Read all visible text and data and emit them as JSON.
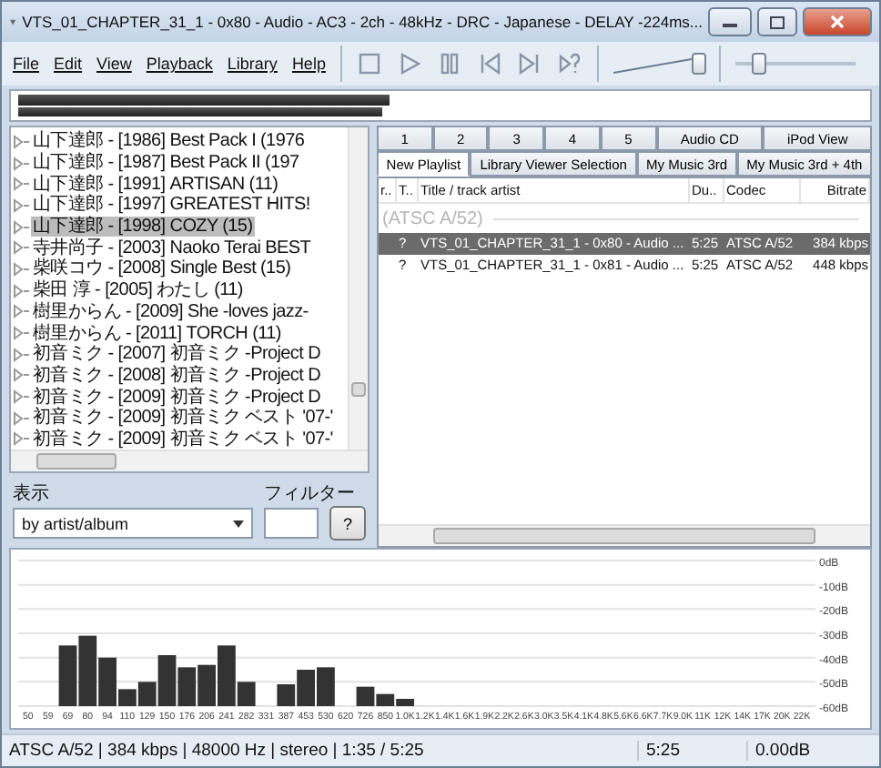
{
  "window": {
    "title": "VTS_01_CHAPTER_31_1 - 0x80 - Audio - AC3 - 2ch - 48kHz - DRC - Japanese - DELAY -224ms..."
  },
  "menu": [
    "File",
    "Edit",
    "View",
    "Playback",
    "Library",
    "Help"
  ],
  "volume": {
    "level": 0.95
  },
  "seek": {
    "level": 0.2
  },
  "peak_meter": [
    {
      "level": 0.44
    },
    {
      "level": 0.43
    }
  ],
  "library_tree": {
    "items": [
      {
        "label": "山下達郎 - [1986] Best Pack I (1976",
        "selected": false
      },
      {
        "label": "山下達郎 - [1987] Best Pack II (197",
        "selected": false
      },
      {
        "label": "山下達郎 - [1991] ARTISAN (11)",
        "selected": false
      },
      {
        "label": "山下達郎 - [1997] GREATEST HITS!",
        "selected": false
      },
      {
        "label": "山下達郎 - [1998] COZY (15)",
        "selected": true
      },
      {
        "label": "寺井尚子 - [2003] Naoko Terai BEST",
        "selected": false
      },
      {
        "label": "柴咲コウ - [2008] Single Best (15)",
        "selected": false
      },
      {
        "label": "柴田 淳 - [2005] わたし (11)",
        "selected": false
      },
      {
        "label": "樹里からん - [2009] She -loves jazz-",
        "selected": false
      },
      {
        "label": "樹里からん - [2011] TORCH (11)",
        "selected": false
      },
      {
        "label": "初音ミク - [2007] 初音ミク -Project D",
        "selected": false
      },
      {
        "label": "初音ミク - [2008] 初音ミク -Project D",
        "selected": false
      },
      {
        "label": "初音ミク - [2009] 初音ミク -Project D",
        "selected": false
      },
      {
        "label": "初音ミク - [2009] 初音ミク ベスト '07-'",
        "selected": false
      },
      {
        "label": "初音ミク - [2009] 初音ミク ベスト '07-'",
        "selected": false
      }
    ],
    "view_label": "表示",
    "view_value": "by artist/album",
    "filter_label": "フィルター",
    "help_button": "?"
  },
  "tabs_row_1": [
    {
      "label": "1",
      "selected": false
    },
    {
      "label": "2",
      "selected": false
    },
    {
      "label": "3",
      "selected": false
    },
    {
      "label": "4",
      "selected": false
    },
    {
      "label": "5",
      "selected": false
    },
    {
      "label": "Audio CD",
      "selected": false
    },
    {
      "label": "iPod View",
      "selected": false
    }
  ],
  "tabs_row_2": [
    {
      "label": "New Playlist",
      "selected": true
    },
    {
      "label": "Library Viewer Selection",
      "selected": false
    },
    {
      "label": "My Music 3rd",
      "selected": false
    },
    {
      "label": "My Music 3rd + 4th",
      "selected": false
    }
  ],
  "playlist": {
    "columns": [
      "r..",
      "T..",
      "Title / track artist",
      "Du..",
      "Codec",
      "Bitrate"
    ],
    "group": "(ATSC A/52)",
    "rows": [
      {
        "cells": [
          "",
          "?",
          "VTS_01_CHAPTER_31_1 - 0x80 - Audio ...",
          "5:25",
          "ATSC A/52",
          "384 kbps"
        ],
        "selected": true
      },
      {
        "cells": [
          "",
          "?",
          "VTS_01_CHAPTER_31_1 - 0x81 - Audio ...",
          "5:25",
          "ATSC A/52",
          "448 kbps"
        ],
        "selected": false
      }
    ]
  },
  "spectrum": {
    "frequency_labels": [
      "50",
      "59",
      "69",
      "80",
      "94",
      "110",
      "129",
      "150",
      "176",
      "206",
      "241",
      "282",
      "331",
      "387",
      "453",
      "530",
      "620",
      "726",
      "850",
      "1.0K",
      "1.2K",
      "1.4K",
      "1.6K",
      "1.9K",
      "2.2K",
      "2.6K",
      "3.0K",
      "3.5K",
      "4.1K",
      "4.8K",
      "5.6K",
      "6.6K",
      "7.7K",
      "9.0K",
      "11K",
      "12K",
      "14K",
      "17K",
      "20K",
      "22K"
    ],
    "level_labels": [
      "0dB",
      "-10dB",
      "-20dB",
      "-30dB",
      "-40dB",
      "-50dB",
      "-60dB"
    ]
  },
  "status_bar": [
    "ATSC A/52 | 384 kbps | 48000 Hz | stereo | 1:35 / 5:25",
    "5:25",
    "0.00dB"
  ]
}
